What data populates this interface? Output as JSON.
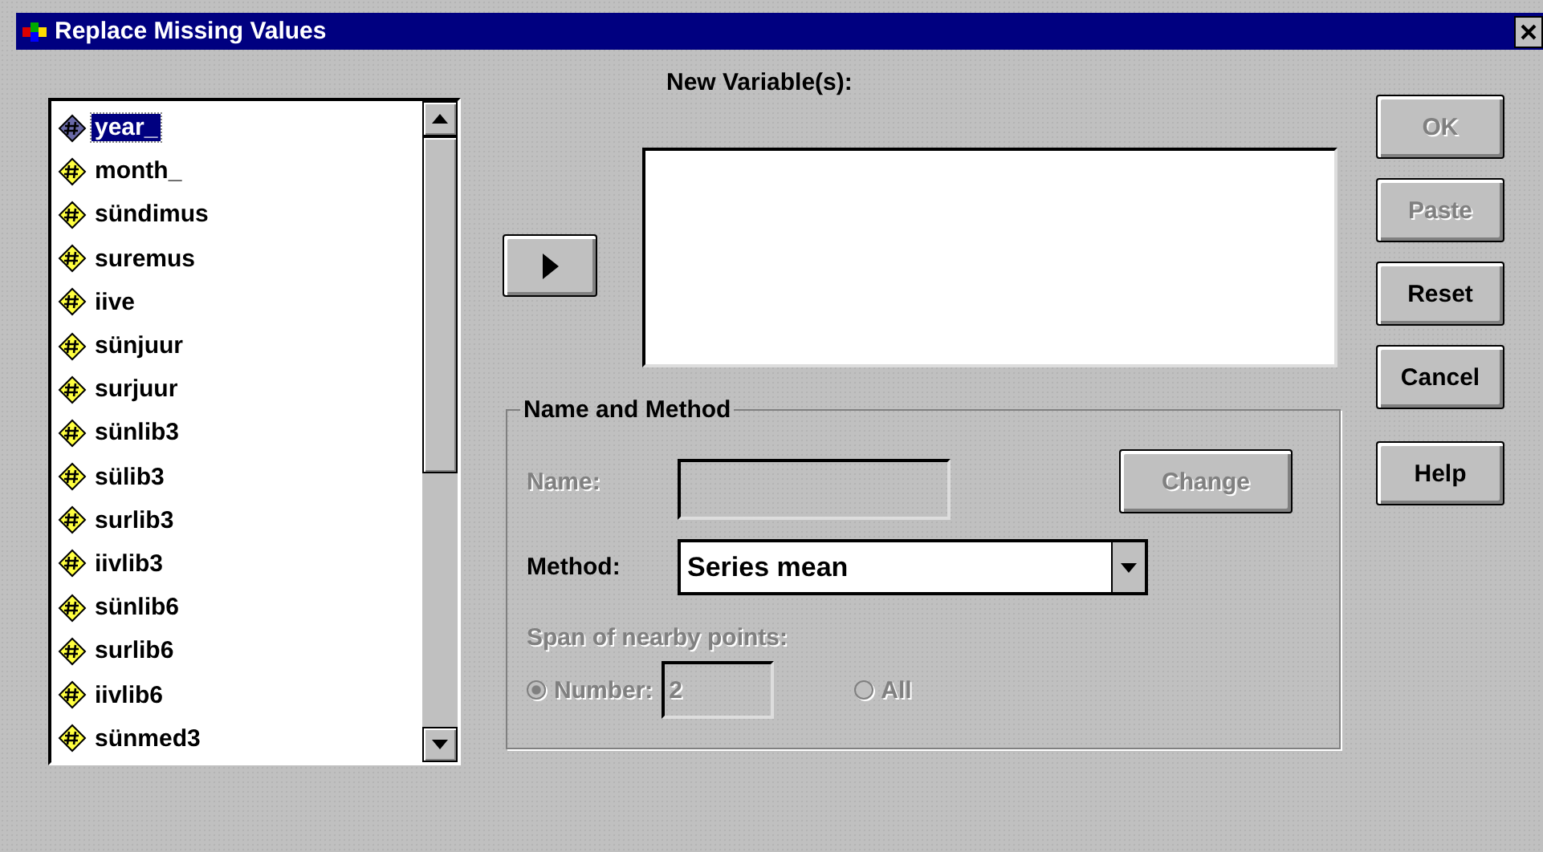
{
  "window": {
    "title": "Replace Missing Values"
  },
  "variables": [
    {
      "name": "year_",
      "selected": true
    },
    {
      "name": "month_",
      "selected": false
    },
    {
      "name": "sündimus",
      "selected": false
    },
    {
      "name": "suremus",
      "selected": false
    },
    {
      "name": "iive",
      "selected": false
    },
    {
      "name": "sünjuur",
      "selected": false
    },
    {
      "name": "surjuur",
      "selected": false
    },
    {
      "name": "sünlib3",
      "selected": false
    },
    {
      "name": "sülib3",
      "selected": false
    },
    {
      "name": "surlib3",
      "selected": false
    },
    {
      "name": "iivlib3",
      "selected": false
    },
    {
      "name": "sünlib6",
      "selected": false
    },
    {
      "name": "surlib6",
      "selected": false
    },
    {
      "name": "iivlib6",
      "selected": false
    },
    {
      "name": "sünmed3",
      "selected": false
    }
  ],
  "new_variables": {
    "label": "New Variable(s):"
  },
  "name_and_method": {
    "title": "Name and Method",
    "name": {
      "label": "Name:",
      "disabled": true
    },
    "change": {
      "label": "Change",
      "disabled": true
    },
    "method": {
      "label": "Method:",
      "value": "Series mean"
    },
    "span": {
      "label": "Span of nearby points:",
      "disabled": true,
      "options": [
        {
          "label": "Number:",
          "selected": true,
          "value": "2"
        },
        {
          "label": "All",
          "selected": false
        }
      ]
    }
  },
  "buttons": [
    {
      "label": "OK",
      "disabled": true
    },
    {
      "label": "Paste",
      "disabled": true
    },
    {
      "label": "Reset",
      "disabled": false
    },
    {
      "label": "Cancel",
      "disabled": false
    },
    {
      "label": "Help",
      "disabled": false
    }
  ]
}
